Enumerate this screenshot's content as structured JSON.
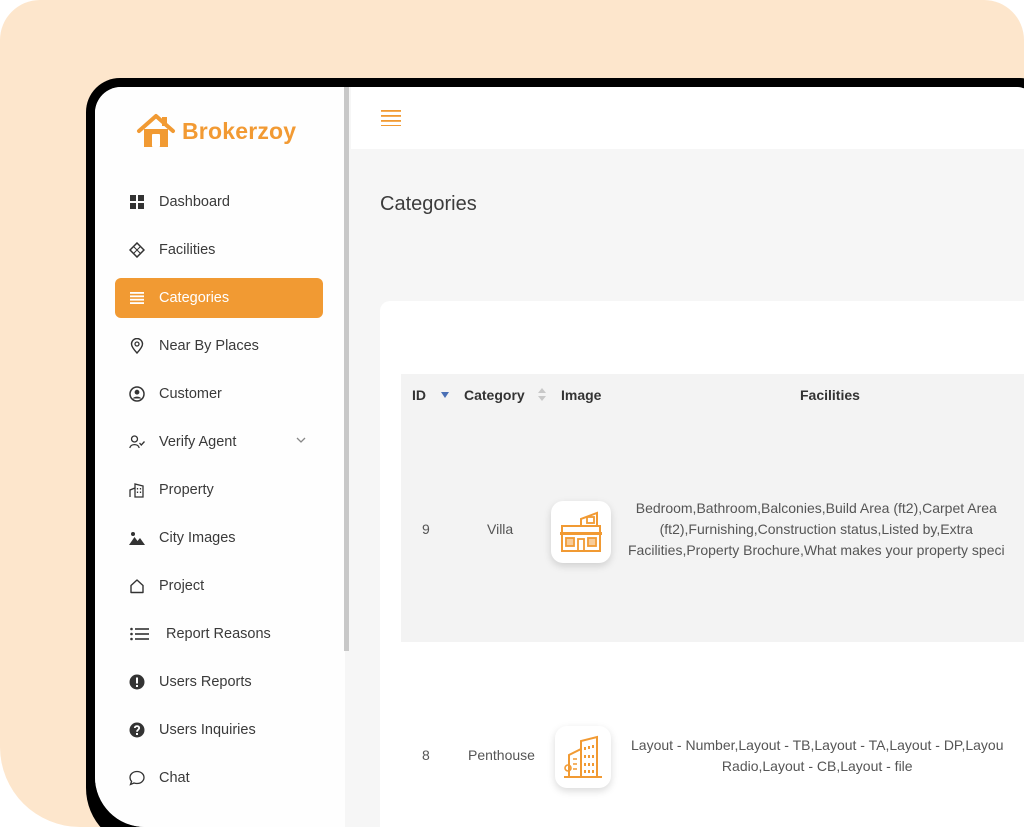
{
  "brand": {
    "name": "Brokerzoy",
    "accent": "#f19a33"
  },
  "sidebar": {
    "items": [
      {
        "label": "Dashboard",
        "icon": "grid-icon"
      },
      {
        "label": "Facilities",
        "icon": "diamond-icon"
      },
      {
        "label": "Categories",
        "icon": "list-icon",
        "active": true
      },
      {
        "label": "Near By Places",
        "icon": "location-pin-icon"
      },
      {
        "label": "Customer",
        "icon": "user-circle-icon"
      },
      {
        "label": "Verify Agent",
        "icon": "user-check-icon",
        "has_submenu": true
      },
      {
        "label": "Property",
        "icon": "building-icon"
      },
      {
        "label": "City Images",
        "icon": "image-icon"
      },
      {
        "label": "Project",
        "icon": "home-outline-icon"
      },
      {
        "label": "Report Reasons",
        "icon": "bullet-list-icon"
      },
      {
        "label": "Users Reports",
        "icon": "exclamation-circle-icon"
      },
      {
        "label": "Users Inquiries",
        "icon": "question-circle-icon"
      },
      {
        "label": "Chat",
        "icon": "chat-bubble-icon"
      }
    ]
  },
  "page": {
    "title": "Categories"
  },
  "table": {
    "headers": {
      "id": "ID",
      "category": "Category",
      "image": "Image",
      "facilities": "Facilities"
    },
    "rows": [
      {
        "id": "9",
        "category": "Villa",
        "image_icon": "villa-icon",
        "facilities_lines": [
          "Bedroom,Bathroom,Balconies,Build Area (ft2),Carpet Area",
          "(ft2),Furnishing,Construction status,Listed by,Extra",
          "Facilities,Property Brochure,What makes your property speci"
        ]
      },
      {
        "id": "8",
        "category": "Penthouse",
        "image_icon": "penthouse-icon",
        "facilities_lines": [
          "Layout - Number,Layout - TB,Layout - TA,Layout - DP,Layou",
          "Radio,Layout - CB,Layout - file"
        ]
      }
    ]
  }
}
